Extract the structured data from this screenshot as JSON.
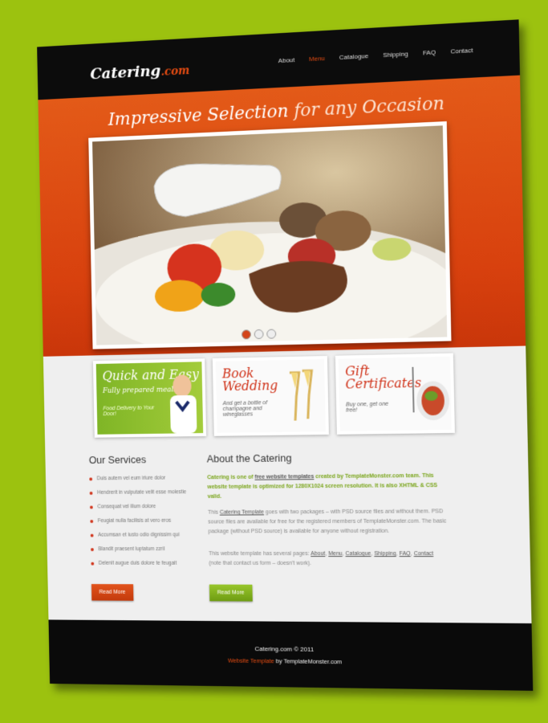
{
  "brand": {
    "name": "Catering",
    "suffix": ".com"
  },
  "nav": [
    {
      "label": "About",
      "active": false
    },
    {
      "label": "Menu",
      "active": true
    },
    {
      "label": "Catalogue",
      "active": false
    },
    {
      "label": "Shipping",
      "active": false
    },
    {
      "label": "FAQ",
      "active": false
    },
    {
      "label": "Contact",
      "active": false
    }
  ],
  "hero": {
    "tagline_a": "Impressive Selection",
    "tagline_b": " for any Occasion",
    "slides": 3,
    "active_slide": 1
  },
  "banners": [
    {
      "title_a": "Quick and Easy",
      "title_b": "Fully prepared meals",
      "sub": "Food Delivery to Your Door!"
    },
    {
      "title_a": "Book",
      "title_b": "Wedding",
      "sub": "And get a bottle of champagne and wineglasses"
    },
    {
      "title_a": "Gift",
      "title_b": "Certificates",
      "sub": "Buy one, get one free!"
    }
  ],
  "services": {
    "title": "Our Services",
    "items": [
      "Duis autem vel eum iriure dolor",
      "Hendrerit in vulputate velit esse molestie",
      "Consequat vel illum dolore",
      "Feugiat nulla facilisis at vero eros",
      "Accumsan et iusto odio dignissim qui",
      "Blandit praesent luptatum zzril",
      "Delenit augue duis dolore te feugait"
    ],
    "button": "Read More"
  },
  "about": {
    "title": "About the Catering",
    "lead_1": "Catering is one of ",
    "lead_link": "free website templates",
    "lead_2": " created by TemplateMonster.com team. This website template is optimized for 1280X1024 screen resolution. It is also XHTML & CSS valid.",
    "p2_1": "This ",
    "p2_link": "Catering Template",
    "p2_2": " goes with two packages – with PSD source files and without them. PSD source files are available for free for the registered members of TemplateMonster.com. The basic package (without PSD source) is available for anyone without registration.",
    "p3_1": "This website template has several pages: ",
    "p3_links": [
      "About",
      "Menu",
      "Catalogue",
      "Shipping",
      "FAQ",
      "Contact"
    ],
    "p3_2": " (note that contact us form – doesn't work).",
    "button": "Read More"
  },
  "footer": {
    "copyright": "Catering.com © 2011",
    "credit_link": "Website Template",
    "credit_rest": " by TemplateMonster.com"
  }
}
